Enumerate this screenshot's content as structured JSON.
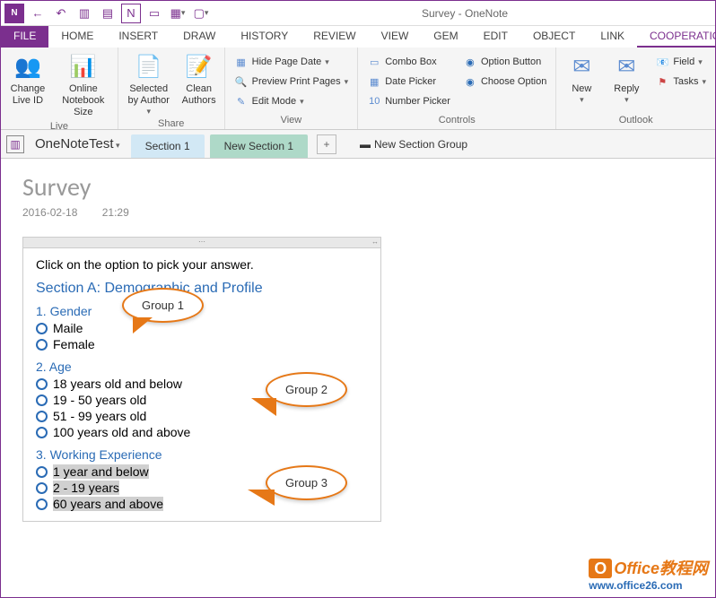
{
  "window": {
    "title": "Survey - OneNote"
  },
  "tabs": {
    "file": "FILE",
    "items": [
      "HOME",
      "INSERT",
      "DRAW",
      "HISTORY",
      "REVIEW",
      "VIEW",
      "GEM",
      "EDIT",
      "OBJECT",
      "LINK",
      "COOPERATION"
    ],
    "active": "COOPERATION"
  },
  "ribbon": {
    "live": {
      "label": "Live",
      "change_id": "Change Live ID",
      "notebook_size": "Online Notebook Size"
    },
    "share": {
      "label": "Share",
      "selected_by_author": "Selected by Author",
      "clean_authors": "Clean Authors"
    },
    "view": {
      "label": "View",
      "hide_date": "Hide Page Date",
      "preview": "Preview Print Pages",
      "edit_mode": "Edit Mode"
    },
    "controls": {
      "label": "Controls",
      "combo": "Combo Box",
      "date_picker": "Date Picker",
      "number_picker": "Number Picker",
      "option_btn": "Option Button",
      "choose_opt": "Choose Option"
    },
    "outlook": {
      "label": "Outlook",
      "new": "New",
      "reply": "Reply",
      "field": "Field",
      "tasks": "Tasks"
    }
  },
  "nav": {
    "notebook": "OneNoteTest",
    "section_active": "New Section 1",
    "section_other": "Section 1",
    "new_group": "New Section Group"
  },
  "page": {
    "title": "Survey",
    "date": "2016-02-18",
    "time": "21:29"
  },
  "content": {
    "instruction": "Click on the option to pick your answer.",
    "section_title": "Section A: Demographic and Profile",
    "q1": {
      "title": "1. Gender",
      "opts": [
        "Maile",
        "Female"
      ]
    },
    "q2": {
      "title": "2. Age",
      "opts": [
        "18 years old and below",
        "19 - 50 years old",
        "51 - 99 years old",
        "100 years old and above"
      ]
    },
    "q3": {
      "title": "3. Working Experience",
      "opts": [
        "1 year and below",
        "2 - 19 years",
        "60 years and above"
      ]
    }
  },
  "callouts": {
    "g1": "Group 1",
    "g2": "Group 2",
    "g3": "Group 3"
  },
  "watermark": {
    "line1a": "O",
    "line1b": "Office教程网",
    "line2": "www.office26.com"
  }
}
